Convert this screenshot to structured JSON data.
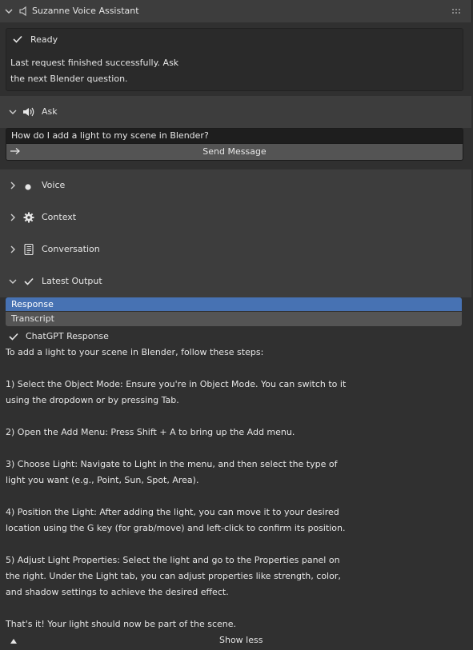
{
  "panel": {
    "title": "Suzanne Voice Assistant",
    "grip": ":::"
  },
  "status": {
    "label": "Ready",
    "message_line1": "Last request finished successfully. Ask",
    "message_line2": "the next Blender question."
  },
  "ask": {
    "header": "Ask",
    "input_value": "How do I add a light to my scene in Blender?",
    "send_label": "Send Message",
    "send_icon": "arrow-right-icon"
  },
  "sections": {
    "voice": "Voice",
    "context": "Context",
    "conversation": "Conversation",
    "latest_output": "Latest Output"
  },
  "output": {
    "tabs": [
      "Response",
      "Transcript"
    ],
    "selected_tab": "Response",
    "chatgpt_label": "ChatGPT Response",
    "lines": [
      "To add a light to your scene in Blender, follow these steps:",
      "",
      "1) Select the Object Mode: Ensure you're in Object Mode. You can switch to it",
      "using the dropdown or by pressing Tab.",
      "",
      "2) Open the Add Menu: Press Shift + A to bring up the Add menu.",
      "",
      "3) Choose Light: Navigate to Light in the menu, and then select the type of",
      "light you want (e.g., Point, Sun, Spot, Area).",
      "",
      "4) Position the Light: After adding the light, you can move it to your desired",
      "location using the G key (for grab/move) and left-click to confirm its position.",
      "",
      "5) Adjust Light Properties: Select the light and go to the Properties panel on",
      "the right. Under the Light tab, you can adjust properties like strength, color,",
      "and shadow settings to achieve the desired effect.",
      "",
      "That's it! Your light should now be part of the scene."
    ],
    "show_less": "Show less"
  },
  "colors": {
    "background": "#303030",
    "header": "#3d3d3d",
    "selected": "#4772b3",
    "button": "#545454",
    "text": "#e6e6e6"
  }
}
